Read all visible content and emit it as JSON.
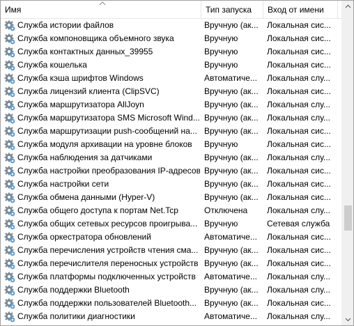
{
  "columns": {
    "name": "Имя",
    "startup_type": "Тип запуска",
    "log_on_as": "Вход от имени"
  },
  "services": [
    {
      "name": "Служба истории файлов",
      "startup": "Вручную (ак...",
      "logon": "Локальная сис..."
    },
    {
      "name": "Служба компоновщика объемного звука",
      "startup": "Вручную",
      "logon": "Локальная сис..."
    },
    {
      "name": "Служба контактных данных_39955",
      "startup": "Вручную",
      "logon": "Локальная сис..."
    },
    {
      "name": "Служба кошелька",
      "startup": "Вручную",
      "logon": "Локальная сис..."
    },
    {
      "name": "Служба кэша шрифтов Windows",
      "startup": "Автоматиче...",
      "logon": "Локальная слу..."
    },
    {
      "name": "Служба лицензий клиента (ClipSVC)",
      "startup": "Вручную (ак...",
      "logon": "Локальная сис..."
    },
    {
      "name": "Служба маршрутизатора AllJoyn",
      "startup": "Вручную (ак...",
      "logon": "Локальная слу..."
    },
    {
      "name": "Служба маршрутизатора SMS Microsoft Wind...",
      "startup": "Вручную (ак...",
      "logon": "Локальная слу..."
    },
    {
      "name": "Служба маршрутизации push-сообщений на...",
      "startup": "Вручную (ак...",
      "logon": "Локальная сис..."
    },
    {
      "name": "Служба модуля архивации на уровне блоков",
      "startup": "Вручную",
      "logon": "Локальная сис..."
    },
    {
      "name": "Служба наблюдения за датчиками",
      "startup": "Вручную (ак...",
      "logon": "Локальная слу..."
    },
    {
      "name": "Служба настройки преобразования IP-адресов",
      "startup": "Вручную (ак...",
      "logon": "Локальная сис..."
    },
    {
      "name": "Служба настройки сети",
      "startup": "Вручную (ак...",
      "logon": "Локальная сис..."
    },
    {
      "name": "Служба обмена данными (Hyper-V)",
      "startup": "Вручную (ак...",
      "logon": "Локальная сис..."
    },
    {
      "name": "Служба общего доступа к портам Net.Tcp",
      "startup": "Отключена",
      "logon": "Локальная слу..."
    },
    {
      "name": "Служба общих сетевых ресурсов проигрыва...",
      "startup": "Вручную",
      "logon": "Сетевая служба"
    },
    {
      "name": "Служба оркестратора обновлений",
      "startup": "Автоматиче...",
      "logon": "Локальная сис..."
    },
    {
      "name": "Служба перечисления устройств чтения сма...",
      "startup": "Вручную (ак...",
      "logon": "Локальная сис..."
    },
    {
      "name": "Служба перечислителя переносных устройств",
      "startup": "Вручную (ак...",
      "logon": "Локальная сис..."
    },
    {
      "name": "Служба платформы подключенных устройств",
      "startup": "Автоматиче...",
      "logon": "Локальная слу..."
    },
    {
      "name": "Служба поддержки Bluetooth",
      "startup": "Вручную (ак...",
      "logon": "Локальная слу..."
    },
    {
      "name": "Служба поддержки пользователей Bluetooth...",
      "startup": "Вручную (ак...",
      "logon": "Локальная сис..."
    },
    {
      "name": "Служба политики диагностики",
      "startup": "Автоматиче...",
      "logon": "Локальная слу..."
    }
  ],
  "icons": {
    "row_icon": "service-gear-icon",
    "sort_indicator": "sort-up-icon",
    "scroll_up": "arrow-up-icon",
    "scroll_down": "arrow-down-icon"
  },
  "colors": {
    "header_separator": "#e5e5e5",
    "border": "#a0a0a0",
    "scrollbar_track": "#f0f0f0",
    "scrollbar_thumb": "#cdcdcd"
  }
}
